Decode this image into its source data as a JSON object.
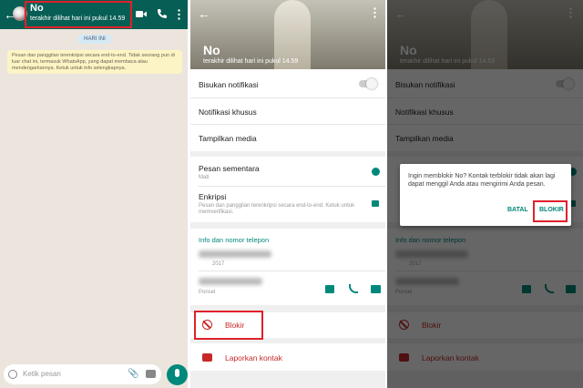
{
  "chat": {
    "contact_name": "No",
    "last_seen": "terakhir dilihat hari ini pukul 14.59",
    "date_pill": "HARI INI",
    "encryption_notice": "Pesan dan panggilan terenkripsi secara end-to-end. Tidak seorang pun di luar chat ini, termasuk WhatsApp, yang dapat membaca atau mendengarkannya. Ketuk untuk info selengkapnya.",
    "input_placeholder": "Ketik pesan",
    "icons": {
      "back": "back-arrow-icon",
      "video": "video-call-icon",
      "call": "phone-icon",
      "more": "more-vert-icon",
      "emoji": "emoji-icon",
      "attach": "paperclip-icon",
      "camera": "camera-icon",
      "mic": "mic-icon"
    }
  },
  "profile": {
    "name": "No",
    "last_seen": "terakhir dilihat hari ini pukul 14.59",
    "mute_label": "Bisukan notifikasi",
    "custom_notif_label": "Notifikasi khusus",
    "media_label": "Tampilkan media",
    "disappearing_label": "Pesan sementara",
    "disappearing_value": "Mati",
    "encryption_label": "Enkripsi",
    "encryption_desc": "Pesan dan panggilan terenkripsi secara end-to-end. Ketuk untuk memverifikasi.",
    "info_title": "Info dan nomor telepon",
    "info_date": "2017",
    "phone_type": "Ponsel",
    "block_label": "Blokir",
    "report_label": "Laporkan kontak"
  },
  "dialog": {
    "message": "Ingin memblokir No? Kontak terblokir tidak akan lagi dapat menggil Anda atau mengirimi Anda pesan.",
    "cancel_label": "BATAL",
    "confirm_label": "BLOKIR"
  },
  "colors": {
    "whatsapp_green": "#075e54",
    "accent_teal": "#00897b",
    "danger_red": "#c62828",
    "highlight_red": "#e0202a"
  }
}
